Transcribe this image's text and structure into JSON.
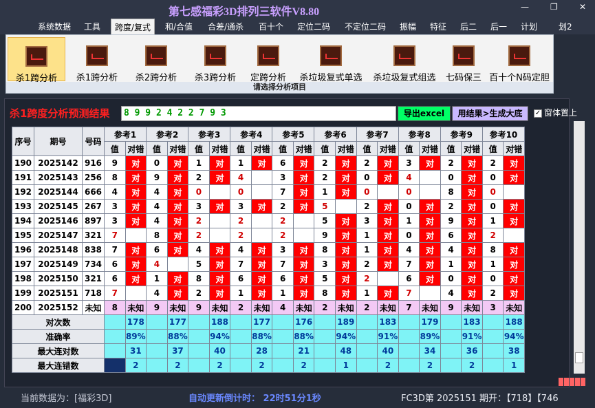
{
  "window": {
    "title": "第七感福彩3D排列三软件V8.80",
    "minimize": "—",
    "restore": "❐",
    "close": "✕"
  },
  "menu": [
    "系统数据",
    "工具",
    "跨度/复式",
    "和/合值",
    "合差/通杀",
    "百十个",
    "定位二码",
    "不定位二码",
    "振幅",
    "特征",
    "后二",
    "后一",
    "计划",
    "划2"
  ],
  "ribbon": {
    "buttons": [
      "杀1跨分析",
      "杀1跨分析",
      "杀2跨分析",
      "杀3跨分析",
      "定跨分析",
      "杀垃圾复式单选",
      "杀垃圾复式组选",
      "七码保三",
      "百十个N码定胆"
    ],
    "footer": "请选择分析项目",
    "active_index": 0
  },
  "result": {
    "title": "杀1跨度分析预测结果",
    "value": "8 9 9 2 4 2 2 7 9 3",
    "export_btn": "导出excel",
    "gen_btn": "用结果>生成大底",
    "ontop_label": "窗体置上",
    "ontop_mark": "✓"
  },
  "table": {
    "headers": [
      "序号",
      "期号",
      "号码"
    ],
    "refs": [
      "参考1",
      "参考2",
      "参考3",
      "参考4",
      "参考5",
      "参考6",
      "参考7",
      "参考8",
      "参考9",
      "参考10"
    ],
    "sub": [
      "值",
      "对错"
    ],
    "rows": [
      {
        "seq": "190",
        "issue": "2025142",
        "num": "916",
        "cells": [
          [
            "9",
            "对"
          ],
          [
            "0",
            "对"
          ],
          [
            "1",
            "对"
          ],
          [
            "1",
            "对"
          ],
          [
            "6",
            "对"
          ],
          [
            "2",
            "对"
          ],
          [
            "2",
            "对"
          ],
          [
            "3",
            "对"
          ],
          [
            "2",
            "对"
          ],
          [
            "2",
            "对"
          ]
        ]
      },
      {
        "seq": "191",
        "issue": "2025143",
        "num": "256",
        "cells": [
          [
            "8",
            "对"
          ],
          [
            "9",
            "对"
          ],
          [
            "2",
            "对"
          ],
          [
            "4",
            ""
          ],
          [
            "3",
            "对"
          ],
          [
            "2",
            "对"
          ],
          [
            "0",
            "对"
          ],
          [
            "4",
            ""
          ],
          [
            "0",
            "对"
          ],
          [
            "0",
            "对"
          ]
        ]
      },
      {
        "seq": "192",
        "issue": "2025144",
        "num": "666",
        "cells": [
          [
            "4",
            "对"
          ],
          [
            "4",
            "对"
          ],
          [
            "0",
            ""
          ],
          [
            "0",
            ""
          ],
          [
            "7",
            "对"
          ],
          [
            "1",
            "对"
          ],
          [
            "0",
            ""
          ],
          [
            "0",
            ""
          ],
          [
            "8",
            "对"
          ],
          [
            "0",
            ""
          ]
        ]
      },
      {
        "seq": "193",
        "issue": "2025145",
        "num": "267",
        "cells": [
          [
            "3",
            "对"
          ],
          [
            "4",
            "对"
          ],
          [
            "3",
            "对"
          ],
          [
            "3",
            "对"
          ],
          [
            "2",
            "对"
          ],
          [
            "5",
            ""
          ],
          [
            "2",
            "对"
          ],
          [
            "0",
            "对"
          ],
          [
            "2",
            "对"
          ],
          [
            "0",
            "对"
          ]
        ]
      },
      {
        "seq": "194",
        "issue": "2025146",
        "num": "897",
        "cells": [
          [
            "3",
            "对"
          ],
          [
            "4",
            "对"
          ],
          [
            "2",
            ""
          ],
          [
            "2",
            ""
          ],
          [
            "2",
            ""
          ],
          [
            "5",
            "对"
          ],
          [
            "3",
            "对"
          ],
          [
            "1",
            "对"
          ],
          [
            "9",
            "对"
          ],
          [
            "1",
            "对"
          ]
        ]
      },
      {
        "seq": "195",
        "issue": "2025147",
        "num": "321",
        "cells": [
          [
            "7",
            ""
          ],
          [
            "8",
            "对"
          ],
          [
            "2",
            ""
          ],
          [
            "2",
            ""
          ],
          [
            "2",
            ""
          ],
          [
            "9",
            "对"
          ],
          [
            "1",
            "对"
          ],
          [
            "0",
            "对"
          ],
          [
            "6",
            "对"
          ],
          [
            "2",
            ""
          ]
        ]
      },
      {
        "seq": "196",
        "issue": "2025148",
        "num": "838",
        "cells": [
          [
            "7",
            "对"
          ],
          [
            "6",
            "对"
          ],
          [
            "4",
            "对"
          ],
          [
            "4",
            "对"
          ],
          [
            "3",
            "对"
          ],
          [
            "8",
            "对"
          ],
          [
            "1",
            "对"
          ],
          [
            "4",
            "对"
          ],
          [
            "4",
            "对"
          ],
          [
            "8",
            "对"
          ]
        ]
      },
      {
        "seq": "197",
        "issue": "2025149",
        "num": "734",
        "cells": [
          [
            "6",
            "对"
          ],
          [
            "4",
            ""
          ],
          [
            "5",
            "对"
          ],
          [
            "7",
            "对"
          ],
          [
            "7",
            "对"
          ],
          [
            "3",
            "对"
          ],
          [
            "2",
            "对"
          ],
          [
            "7",
            "对"
          ],
          [
            "1",
            "对"
          ],
          [
            "1",
            "对"
          ]
        ]
      },
      {
        "seq": "198",
        "issue": "2025150",
        "num": "321",
        "cells": [
          [
            "6",
            "对"
          ],
          [
            "1",
            "对"
          ],
          [
            "8",
            "对"
          ],
          [
            "6",
            "对"
          ],
          [
            "6",
            "对"
          ],
          [
            "5",
            "对"
          ],
          [
            "2",
            ""
          ],
          [
            "6",
            "对"
          ],
          [
            "0",
            "对"
          ],
          [
            "0",
            "对"
          ]
        ]
      },
      {
        "seq": "199",
        "issue": "2025151",
        "num": "718",
        "cells": [
          [
            "7",
            ""
          ],
          [
            "4",
            "对"
          ],
          [
            "2",
            "对"
          ],
          [
            "1",
            "对"
          ],
          [
            "1",
            "对"
          ],
          [
            "8",
            "对"
          ],
          [
            "1",
            "对"
          ],
          [
            "7",
            ""
          ],
          [
            "4",
            "对"
          ],
          [
            "2",
            "对"
          ]
        ]
      }
    ],
    "pending": {
      "seq": "200",
      "issue": "2025152",
      "num": "未知",
      "cells": [
        [
          "8",
          "未知"
        ],
        [
          "9",
          "未知"
        ],
        [
          "9",
          "未知"
        ],
        [
          "2",
          "未知"
        ],
        [
          "4",
          "未知"
        ],
        [
          "2",
          "未知"
        ],
        [
          "2",
          "未知"
        ],
        [
          "7",
          "未知"
        ],
        [
          "9",
          "未知"
        ],
        [
          "3",
          "未知"
        ]
      ]
    },
    "stats": [
      {
        "label": "对次数",
        "values": [
          "178",
          "177",
          "188",
          "177",
          "176",
          "189",
          "183",
          "179",
          "183",
          "188"
        ]
      },
      {
        "label": "准确率",
        "values": [
          "89%",
          "88%",
          "94%",
          "88%",
          "88%",
          "94%",
          "91%",
          "89%",
          "91%",
          "94%"
        ]
      },
      {
        "label": "最大连对数",
        "values": [
          "31",
          "37",
          "40",
          "28",
          "21",
          "48",
          "40",
          "34",
          "36",
          "38"
        ]
      },
      {
        "label": "最大连错数",
        "values": [
          "2",
          "2",
          "2",
          "2",
          "2",
          "1",
          "2",
          "2",
          "2",
          "1"
        ]
      }
    ]
  },
  "status": {
    "current_data": "当前数据为：[福彩3D]",
    "countdown": "自动更新倒计时：  22时51分1秒",
    "issue": "FC3D第 2025151 期开：【718】【746"
  },
  "colors": {
    "wrong": "#ff0000",
    "pending": "#f3c9f5",
    "stats": "#7ff3f6",
    "active_button": "#fde28a"
  }
}
